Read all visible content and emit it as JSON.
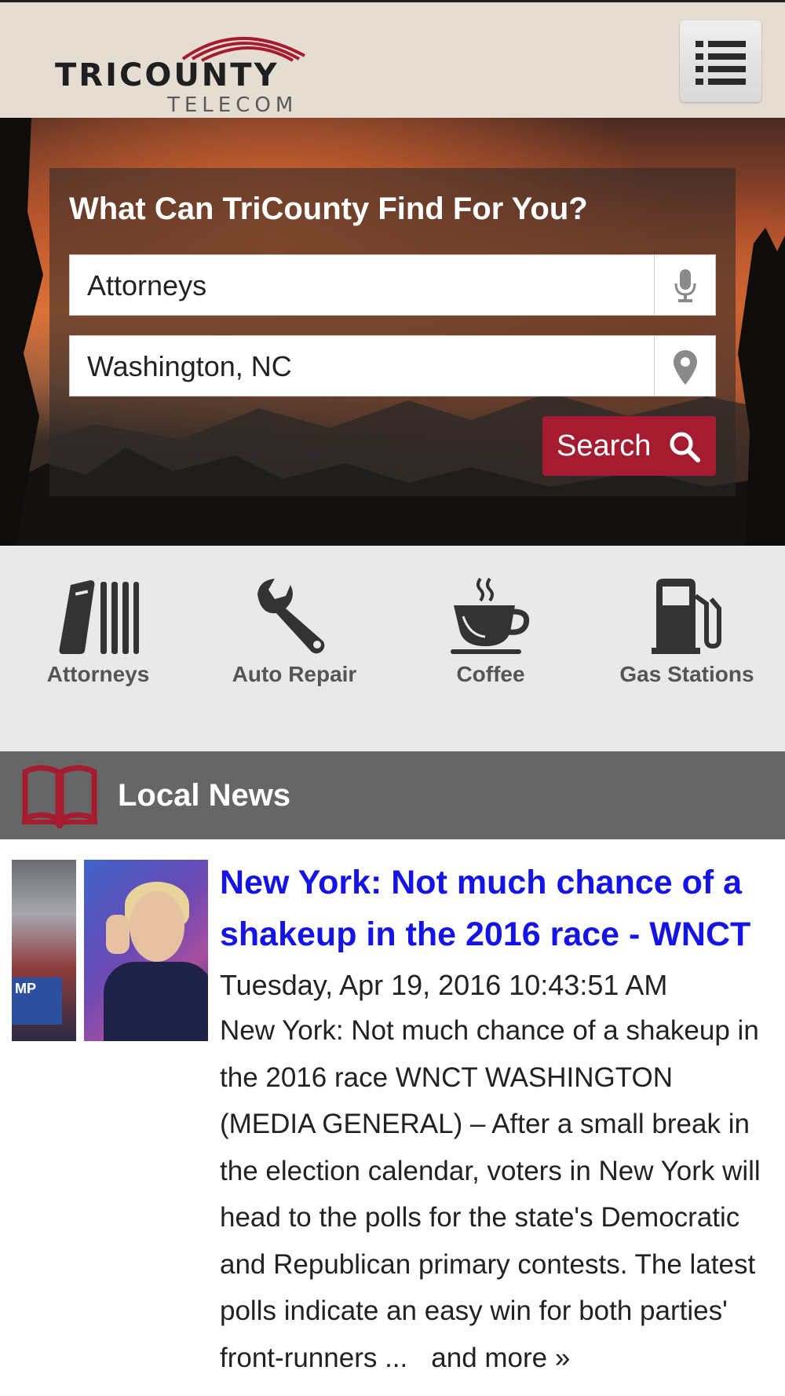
{
  "header": {
    "logo_main": "TRICOUNTY",
    "logo_sub": "TELECOM",
    "menu_icon": "hamburger-menu-icon"
  },
  "search": {
    "title": "What Can TriCounty Find For You?",
    "what_value": "Attorneys",
    "where_value": "Washington, NC",
    "button_label": "Search",
    "mic_icon": "microphone-icon",
    "location_icon": "map-pin-icon",
    "search_icon": "magnifier-icon"
  },
  "categories": [
    {
      "label": "Attorneys",
      "icon": "law-books-icon"
    },
    {
      "label": "Auto Repair",
      "icon": "wrench-icon"
    },
    {
      "label": "Coffee",
      "icon": "coffee-cup-icon"
    },
    {
      "label": "Gas Stations",
      "icon": "gas-pump-icon"
    }
  ],
  "news": {
    "section_title": "Local News",
    "section_icon": "open-book-icon",
    "item": {
      "headline": "New York: Not much chance of a shakeup in the 2016 race - WNCT",
      "date": "Tuesday, Apr 19, 2016 10:43:51 AM",
      "summary": "New York: Not much chance of a shakeup in the 2016 race WNCT   WASHINGTON (MEDIA GENERAL) – After a small break in the election calendar, voters in New York will head to the polls for the state's Democratic and Republican primary contests. The latest polls indicate an easy win for both parties' front-runners ...",
      "more_label": "and more »",
      "thumb_sign_text": "MP"
    }
  },
  "colors": {
    "accent": "#a51c30",
    "header_bg": "#e5ddd2",
    "news_bar": "#666666",
    "headline": "#1414e6"
  }
}
